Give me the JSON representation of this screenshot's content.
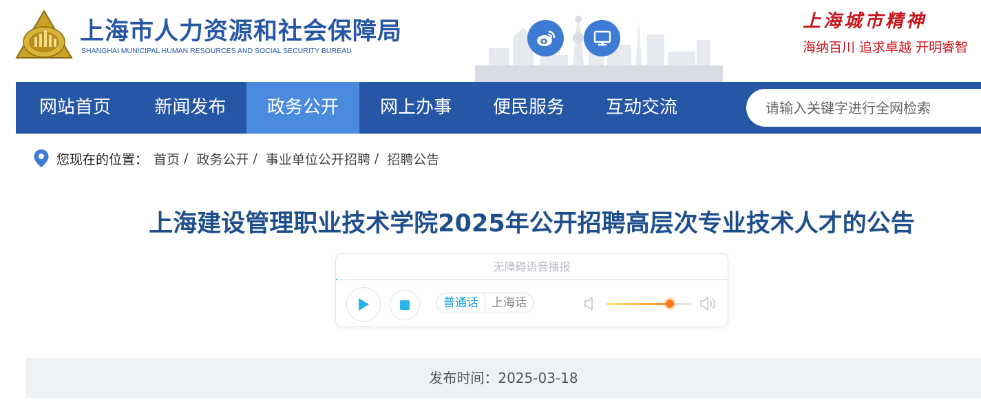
{
  "header": {
    "title": "上海市人力资源和社会保障局",
    "subtitle": "SHANGHAI MUNICIPAL HUMAN RESOURCES AND SOCIAL SECURITY BUREAU",
    "spirit_title": "上海城市精神",
    "spirit_motto": "海纳百川  追求卓越  开明睿智"
  },
  "nav": {
    "items": [
      {
        "label": "网站首页"
      },
      {
        "label": "新闻发布"
      },
      {
        "label": "政务公开"
      },
      {
        "label": "网上办事"
      },
      {
        "label": "便民服务"
      },
      {
        "label": "互动交流"
      }
    ],
    "active_index": 2,
    "search_placeholder": "请输入关键字进行全网检索"
  },
  "breadcrumb": {
    "label": "您现在的位置：",
    "items": [
      "首页",
      "政务公开",
      "事业单位公开招聘",
      "招聘公告"
    ],
    "separator": "/"
  },
  "article": {
    "title": "上海建设管理职业技术学院2025年公开招聘高层次专业技术人才的公告",
    "publish_text": "发布时间：2025-03-18"
  },
  "player": {
    "label": "无障碍语音播报",
    "languages": [
      "普通话",
      "上海话"
    ],
    "selected_language": "普通话",
    "volume": 0.75
  },
  "colors": {
    "primary": "#2657a6",
    "nav_active": "#4a8be0",
    "title": "#1f4e8c",
    "spirit": "#c8161d"
  },
  "icons": [
    "emblem-logo",
    "weibo-icon",
    "desktop-icon",
    "location-pin-icon",
    "play-icon",
    "stop-icon",
    "volume-low-icon",
    "volume-high-icon"
  ]
}
